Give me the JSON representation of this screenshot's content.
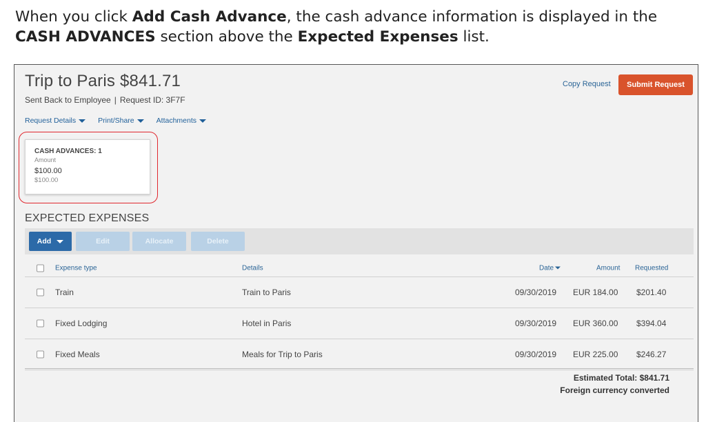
{
  "caption": {
    "part1": "When you click ",
    "bold1": "Add Cash Advance",
    "part2": ", the cash advance information is displayed in the ",
    "bold2": "CASH ADVANCES",
    "part3": " section above the ",
    "bold3": "Expected Expenses",
    "part4": " list."
  },
  "header": {
    "title": "Trip to Paris $841.71",
    "status": "Sent Back to Employee",
    "separator": "|",
    "request_id": "Request ID: 3F7F",
    "copy_label": "Copy Request",
    "submit_label": "Submit Request"
  },
  "menus": {
    "details": "Request Details",
    "print": "Print/Share",
    "attachments": "Attachments"
  },
  "cash_advance": {
    "title": "CASH ADVANCES: 1",
    "subtitle": "Amount",
    "amount": "$100.00",
    "amount_secondary": "$100.00"
  },
  "expenses": {
    "section_title": "EXPECTED EXPENSES",
    "buttons": {
      "add": "Add",
      "edit": "Edit",
      "allocate": "Allocate",
      "delete": "Delete"
    },
    "columns": {
      "type": "Expense type",
      "details": "Details",
      "date": "Date",
      "amount": "Amount",
      "requested": "Requested"
    },
    "rows": [
      {
        "type": "Train",
        "details": "Train to Paris",
        "date": "09/30/2019",
        "amount": "EUR 184.00",
        "requested": "$201.40"
      },
      {
        "type": "Fixed Lodging",
        "details": "Hotel in Paris",
        "date": "09/30/2019",
        "amount": "EUR 360.00",
        "requested": "$394.04"
      },
      {
        "type": "Fixed Meals",
        "details": "Meals for Trip to Paris",
        "date": "09/30/2019",
        "amount": "EUR 225.00",
        "requested": "$246.27"
      }
    ],
    "total": "Estimated Total: $841.71",
    "currency_note": "Foreign currency converted"
  },
  "colors": {
    "submit": "#d9532c",
    "add_button": "#2c6aa8",
    "link": "#2a6496",
    "highlight": "#e0262d"
  },
  "icons": {
    "menu_caret": "caret-down-icon",
    "sort": "sort-desc-icon"
  }
}
